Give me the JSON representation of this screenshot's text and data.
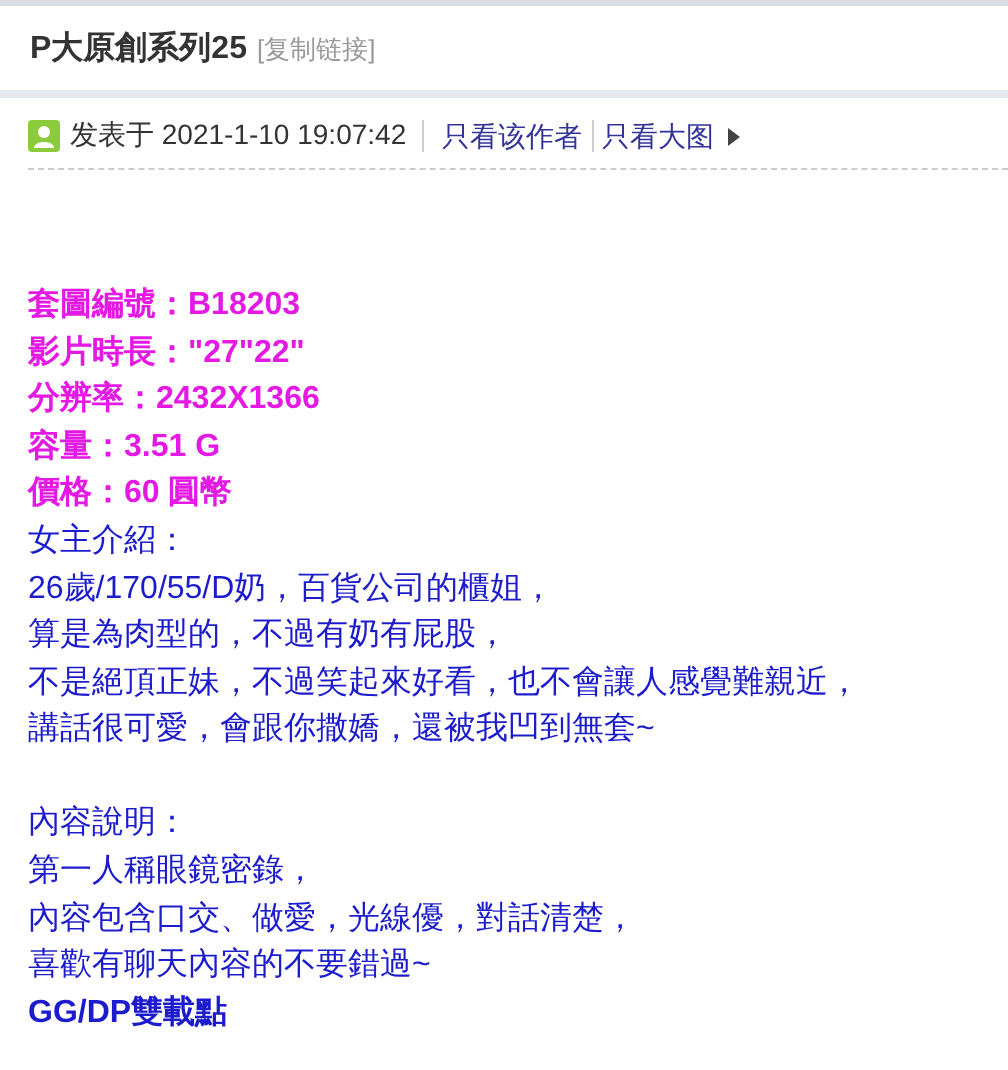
{
  "post": {
    "title": "P大原創系列25",
    "copy_link": "[复制链接]"
  },
  "meta": {
    "posted": "发表于 2021-1-10 19:07:42",
    "links": [
      "只看该作者",
      "只看大图"
    ]
  },
  "blocks": [
    {
      "lines": [
        {
          "kind": "highlight",
          "text": "套圖編號：B18203"
        },
        {
          "kind": "highlight",
          "text": "影片時長：\"27\"22\""
        },
        {
          "kind": "highlight",
          "text": "分辨率：2432X1366"
        },
        {
          "kind": "highlight",
          "text": "容量：3.51 G"
        },
        {
          "kind": "highlight",
          "text": "價格：60 圓幣"
        },
        {
          "kind": "plain",
          "text": "女主介紹："
        },
        {
          "kind": "plain",
          "text": "26歲/170/55/D奶，百貨公司的櫃姐，"
        },
        {
          "kind": "plain",
          "text": "算是為肉型的，不過有奶有屁股，"
        },
        {
          "kind": "plain",
          "text": "不是絕頂正妹，不過笑起來好看，也不會讓人感覺難親近，"
        },
        {
          "kind": "plain",
          "text": "講話很可愛，會跟你撒嬌，還被我凹到無套~"
        }
      ]
    },
    {
      "lines": [
        {
          "kind": "plain",
          "text": "內容說明："
        },
        {
          "kind": "plain",
          "text": "第一人稱眼鏡密錄，"
        },
        {
          "kind": "plain",
          "text": "內容包含口交、做愛，光線優，對話清楚，"
        },
        {
          "kind": "plain",
          "text": "喜歡有聊天內容的不要錯過~"
        },
        {
          "kind": "bold",
          "text": "GG/DP雙載點"
        }
      ]
    }
  ]
}
